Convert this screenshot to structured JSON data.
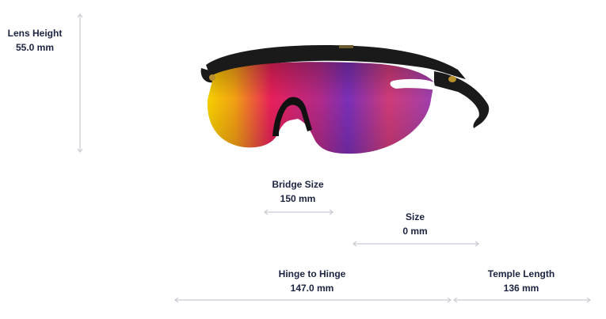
{
  "measurements": {
    "lens_height": {
      "label": "Lens Height",
      "value": "55.0 mm"
    },
    "bridge_size": {
      "label": "Bridge Size",
      "value": "150 mm"
    },
    "size": {
      "label": "Size",
      "value": "0 mm"
    },
    "hinge_to_hinge": {
      "label": "Hinge to Hinge",
      "value": "147.0 mm"
    },
    "temple_length": {
      "label": "Temple Length",
      "value": "136 mm"
    }
  },
  "colors": {
    "text": "#1b2341",
    "arrow": "#c9ccd3",
    "frame": "#1a1a1a",
    "lens_left": "#f5c400",
    "lens_mid": "#e8205a",
    "lens_right": "#7a2fb8",
    "logo_gold": "#b8902e"
  }
}
